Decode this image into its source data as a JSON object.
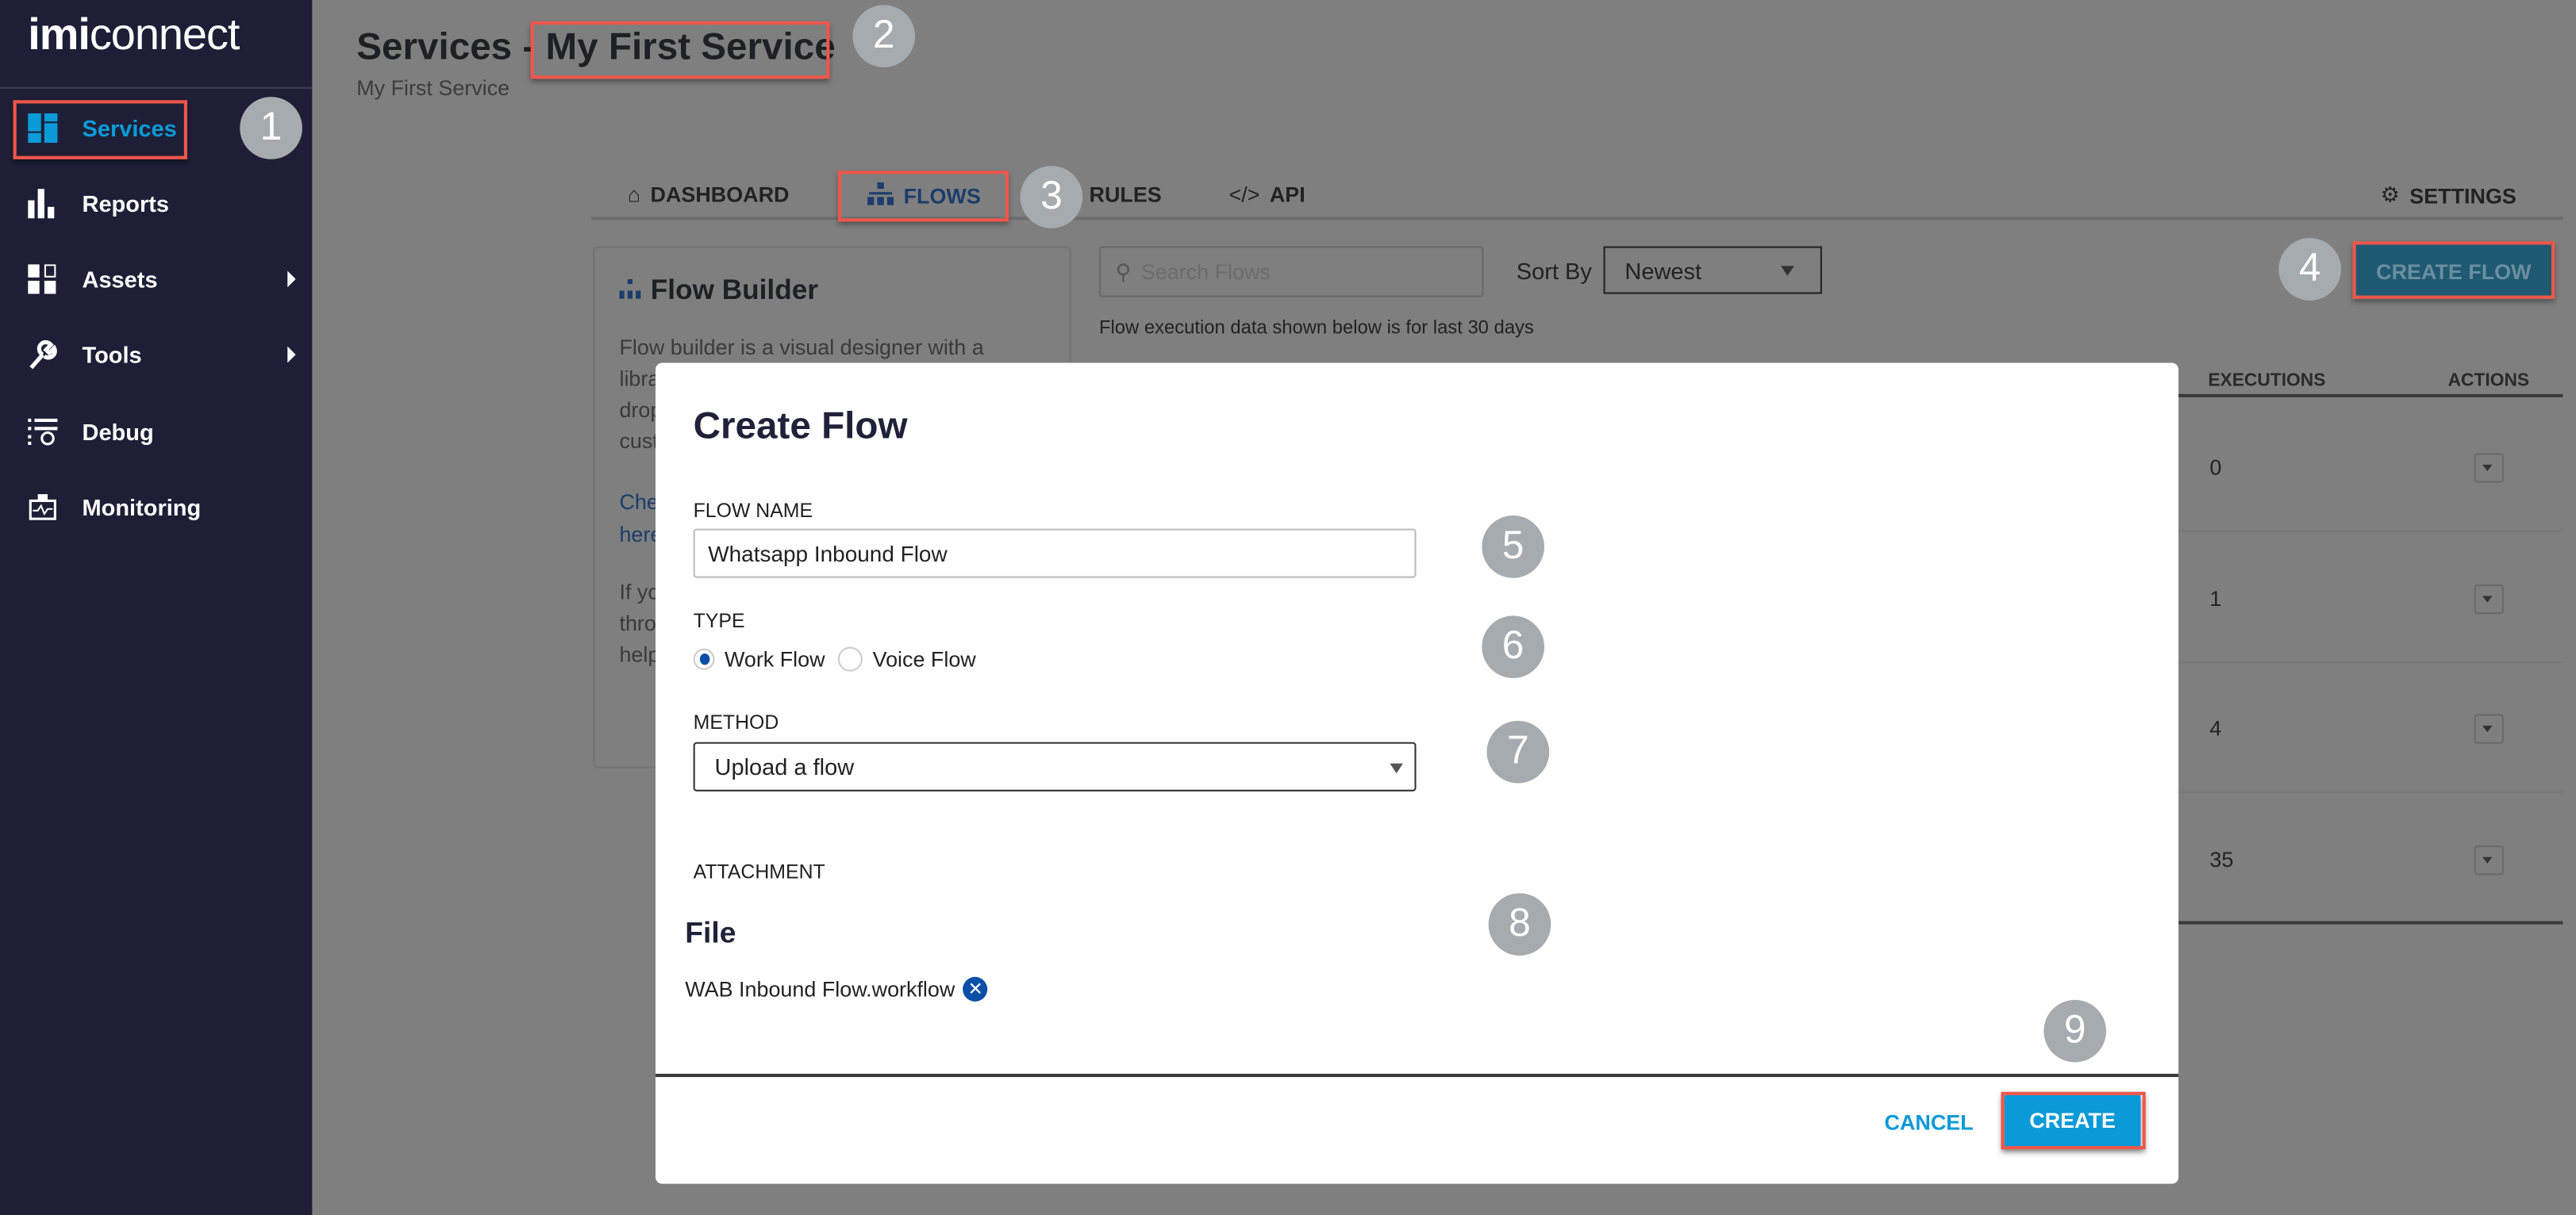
{
  "app": {
    "logo_bold": "imi",
    "logo_rest": "connect"
  },
  "sidebar": {
    "items": [
      {
        "label": "Services",
        "icon": "services-grid-icon",
        "active": true
      },
      {
        "label": "Reports",
        "icon": "bar-chart-icon"
      },
      {
        "label": "Assets",
        "icon": "assets-icon",
        "has_submenu": true
      },
      {
        "label": "Tools",
        "icon": "wrench-icon",
        "has_submenu": true
      },
      {
        "label": "Debug",
        "icon": "debug-list-icon"
      },
      {
        "label": "Monitoring",
        "icon": "monitoring-icon"
      }
    ]
  },
  "header": {
    "title_prefix": "Services - ",
    "title_name": "My First Service",
    "subtitle": "My First Service"
  },
  "tabs": [
    {
      "label": "DASHBOARD",
      "icon": "home-icon"
    },
    {
      "label": "FLOWS",
      "icon": "flow-hierarchy-icon",
      "active": true
    },
    {
      "label": "RULES"
    },
    {
      "label": "API",
      "icon": "code-icon"
    },
    {
      "label": "SETTINGS",
      "icon": "gear-icon"
    }
  ],
  "flow_builder": {
    "title": "Flow Builder",
    "lines": [
      "Flow builder is a visual designer with a",
      "libra",
      "drop",
      "cust"
    ],
    "link_lines": [
      "Che",
      "here"
    ],
    "extra_lines": [
      "If yo",
      "thro",
      "help"
    ]
  },
  "toolbar": {
    "search_placeholder": "Search Flows",
    "sort_label": "Sort By",
    "sort_value": "Newest",
    "create_flow": "CREATE FLOW"
  },
  "note": "Flow execution data shown below is for last 30 days",
  "table": {
    "headers": [
      "EXECUTIONS",
      "ACTIONS"
    ],
    "executions": [
      "0",
      "1",
      "4",
      "35"
    ]
  },
  "modal": {
    "title": "Create Flow",
    "flow_name_label": "FLOW NAME",
    "flow_name_value": "Whatsapp Inbound Flow",
    "type_label": "TYPE",
    "type_options": [
      "Work Flow",
      "Voice Flow"
    ],
    "type_selected": "Work Flow",
    "method_label": "METHOD",
    "method_value": "Upload a flow",
    "attachment_label": "ATTACHMENT",
    "file_heading": "File",
    "file_name": "WAB Inbound Flow.workflow",
    "cancel": "CANCEL",
    "create": "CREATE"
  },
  "callouts": [
    "1",
    "2",
    "3",
    "4",
    "5",
    "6",
    "7",
    "8",
    "9"
  ],
  "colors": {
    "sidebar": "#1e1f36",
    "accent": "#0a9ad8",
    "highlight": "#f0564a",
    "radio": "#0b4fa6",
    "callout": "#a5abaf"
  }
}
